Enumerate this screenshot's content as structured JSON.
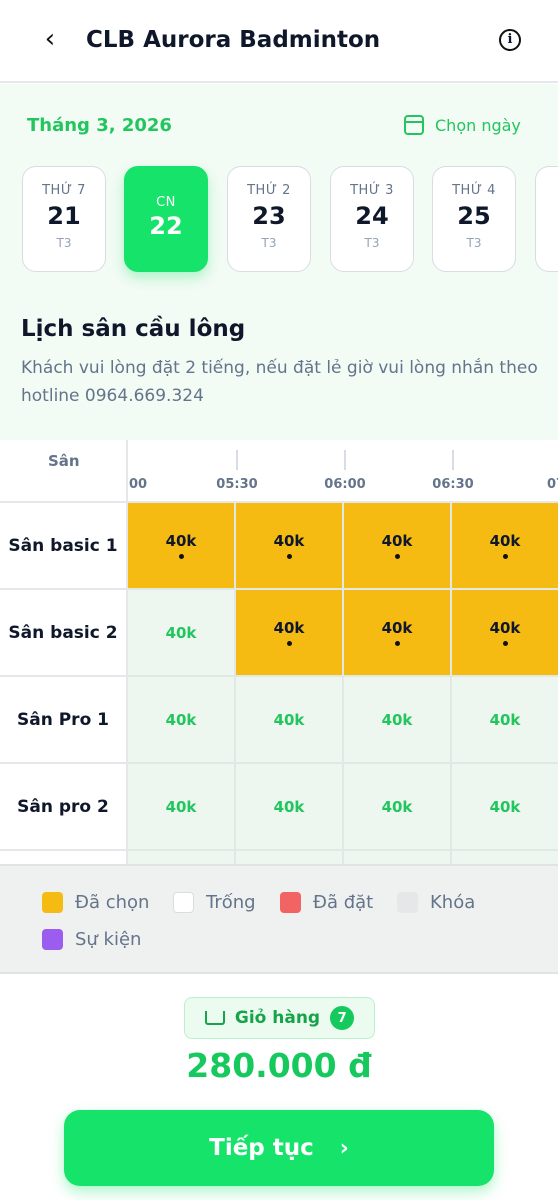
{
  "header": {
    "back_icon": "chevron-left-icon",
    "back_glyph": "‹",
    "title": "CLB Aurora Badminton",
    "info_icon": "info-icon",
    "info_glyph": "i"
  },
  "date_picker": {
    "month_label": "Tháng 3, 2026",
    "pick_label": "Chọn ngày",
    "pick_icon": "calendar-icon",
    "days": [
      {
        "dow": "THỨ 7",
        "num": "21",
        "sub": "T3",
        "selected": false
      },
      {
        "dow": "CN",
        "num": "22",
        "sub": "",
        "selected": true
      },
      {
        "dow": "THỨ 2",
        "num": "23",
        "sub": "T3",
        "selected": false
      },
      {
        "dow": "THỨ 3",
        "num": "24",
        "sub": "T3",
        "selected": false
      },
      {
        "dow": "THỨ 4",
        "num": "25",
        "sub": "T3",
        "selected": false
      }
    ]
  },
  "schedule": {
    "title": "Lịch sân cầu lông",
    "note": "Khách vui lòng đặt 2 tiếng, nếu đặt lẻ giờ vui lòng nhắn theo hotline 0964.669.324"
  },
  "grid": {
    "corner_label": "Sân",
    "times": [
      "00",
      "05:30",
      "06:00",
      "06:30",
      "07"
    ],
    "rows": [
      {
        "name": "Sân basic 1",
        "cells": [
          {
            "price": "40k",
            "state": "chosen"
          },
          {
            "price": "40k",
            "state": "chosen"
          },
          {
            "price": "40k",
            "state": "chosen"
          },
          {
            "price": "40k",
            "state": "chosen"
          }
        ]
      },
      {
        "name": "Sân basic 2",
        "cells": [
          {
            "price": "40k",
            "state": "free"
          },
          {
            "price": "40k",
            "state": "chosen"
          },
          {
            "price": "40k",
            "state": "chosen"
          },
          {
            "price": "40k",
            "state": "chosen"
          }
        ]
      },
      {
        "name": "Sân Pro 1",
        "cells": [
          {
            "price": "40k",
            "state": "free"
          },
          {
            "price": "40k",
            "state": "free"
          },
          {
            "price": "40k",
            "state": "free"
          },
          {
            "price": "40k",
            "state": "free"
          }
        ]
      },
      {
        "name": "Sân pro 2",
        "cells": [
          {
            "price": "40k",
            "state": "free"
          },
          {
            "price": "40k",
            "state": "free"
          },
          {
            "price": "40k",
            "state": "free"
          },
          {
            "price": "40k",
            "state": "free"
          }
        ]
      }
    ]
  },
  "legend": [
    {
      "label": "Đã chọn",
      "color": "#f6bb13"
    },
    {
      "label": "Trống",
      "color": "#ffffff"
    },
    {
      "label": "Đã đặt",
      "color": "#f26464"
    },
    {
      "label": "Khóa",
      "color": "#e5e7e9"
    },
    {
      "label": "Sự kiện",
      "color": "#9b5cf0"
    }
  ],
  "cart": {
    "label": "Giỏ hàng",
    "count": "7",
    "icon": "cart-icon"
  },
  "total": "280.000 đ",
  "cta": {
    "label": "Tiếp tục",
    "icon": "chevron-right-icon",
    "glyph": "›"
  },
  "colors": {
    "accent": "#16e46a",
    "chosen": "#f6bb13",
    "free_bg": "#eef7ef",
    "free_text": "#22c55e"
  }
}
